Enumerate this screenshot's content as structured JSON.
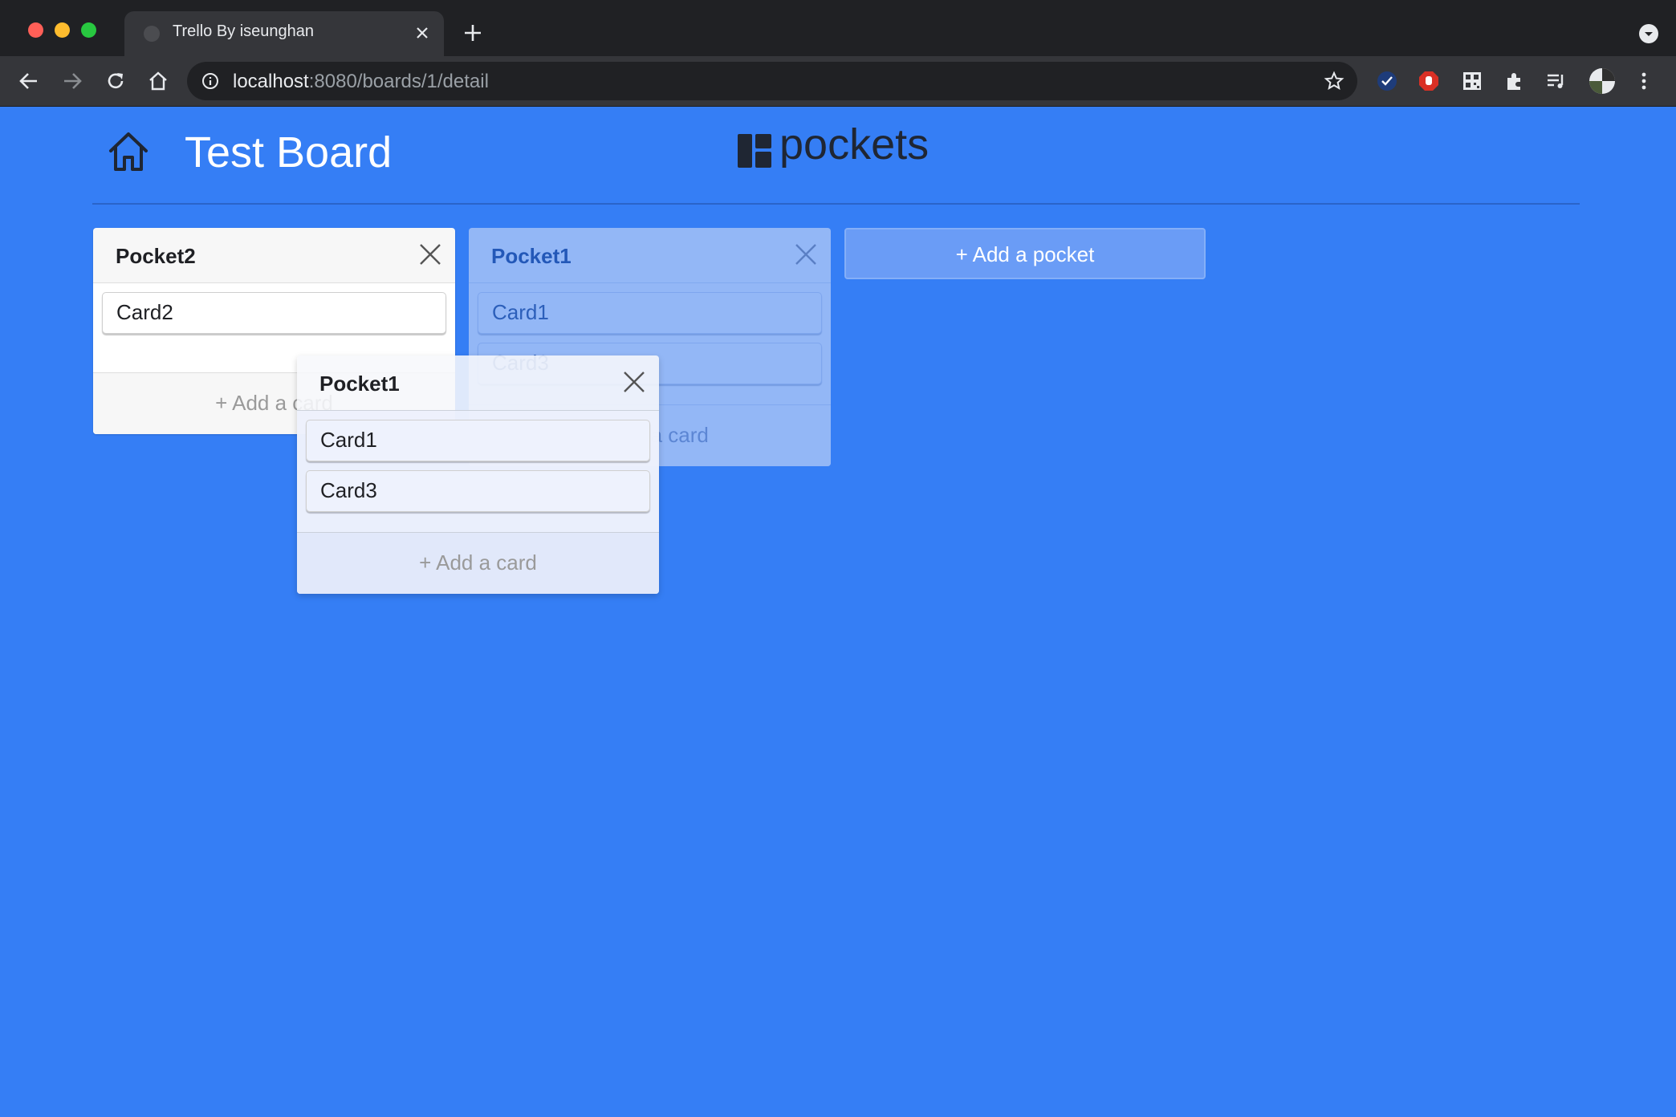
{
  "browser": {
    "tab_title": "Trello By iseunghan",
    "url_host": "localhost",
    "url_path": ":8080/boards/1/detail",
    "icons": [
      "back-icon",
      "forward-icon",
      "reload-icon",
      "home-icon",
      "info-icon",
      "star-icon",
      "extensions-icon",
      "menu-icon"
    ]
  },
  "header": {
    "board_title": "Test Board",
    "logo_text": "pockets"
  },
  "pockets": [
    {
      "title": "Pocket2",
      "cards": [
        "Card2"
      ],
      "add_card_label": "+ Add a card"
    },
    {
      "title": "Pocket1",
      "cards": [
        "Card1",
        "Card3"
      ],
      "add_card_label": "+ Add a card",
      "state": "drag placeholder"
    }
  ],
  "dragged_pocket": {
    "title": "Pocket1",
    "cards": [
      "Card1",
      "Card3"
    ],
    "add_card_label": "+ Add a card"
  },
  "add_pocket_label": "+ Add a pocket",
  "colors": {
    "background": "#357ef5",
    "pocket": "#f7f7f7",
    "logo": "#1f2633"
  }
}
